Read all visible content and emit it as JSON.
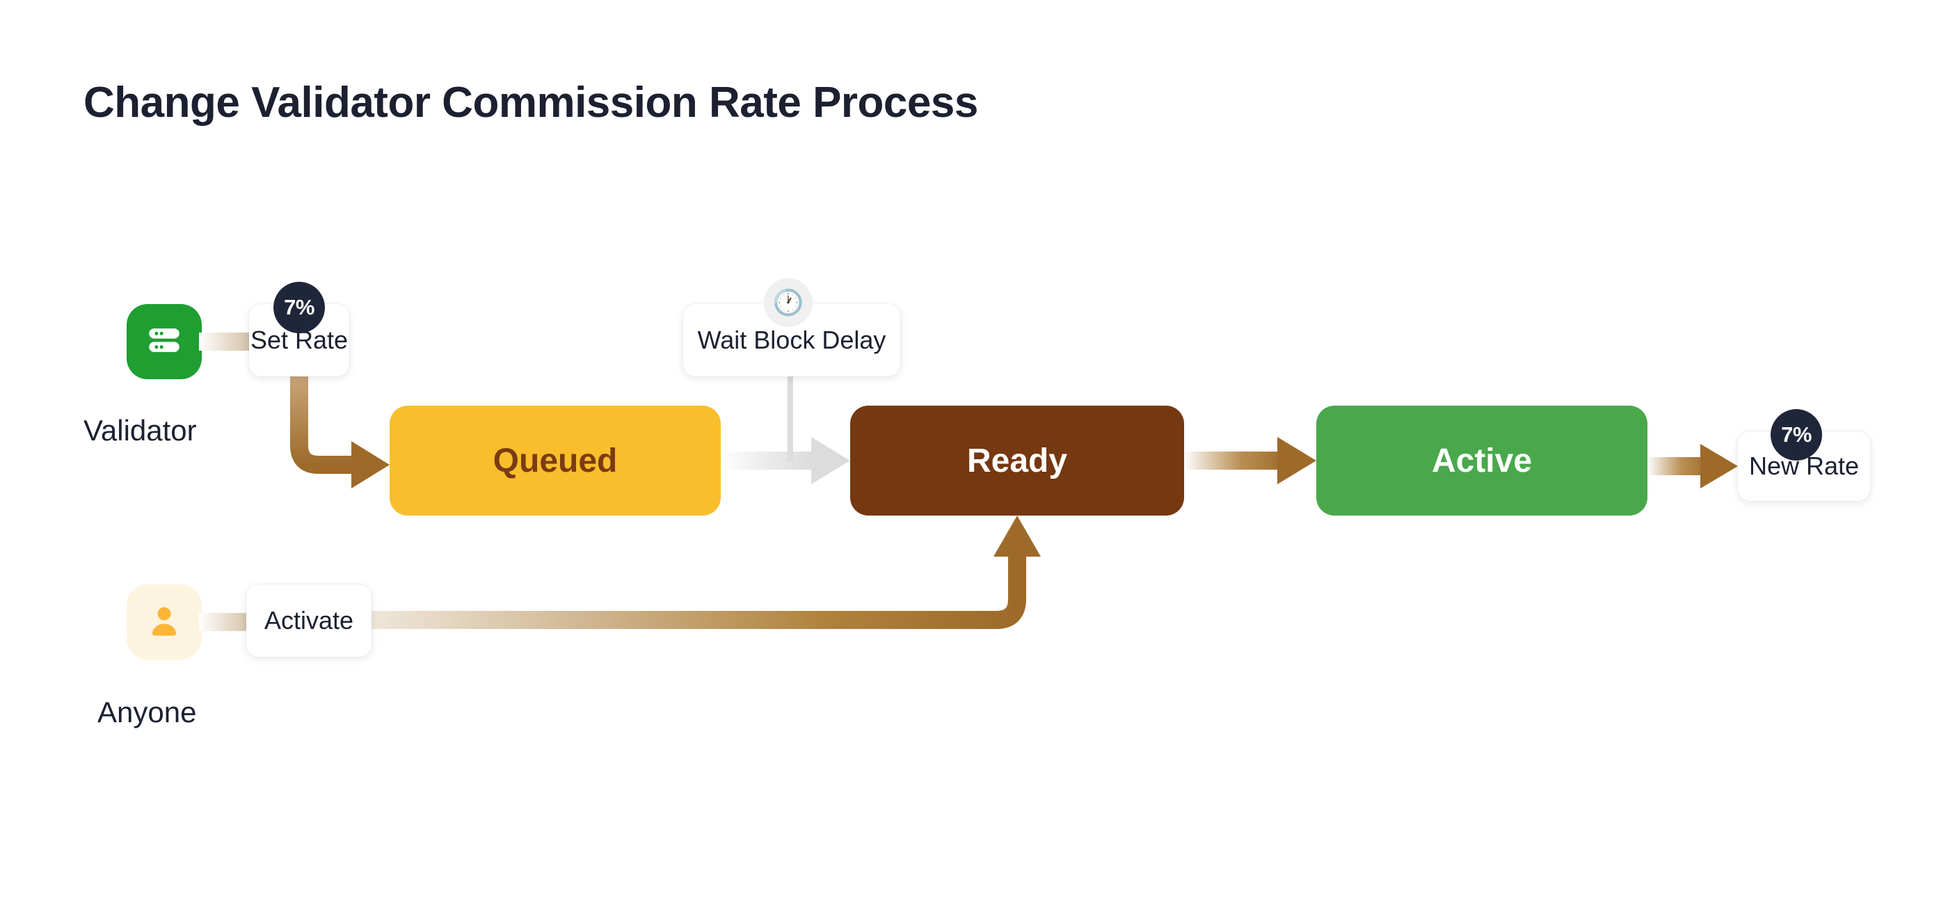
{
  "page": {
    "title": "Change Validator Commission Rate Process",
    "background_color": "#ffffff"
  },
  "actors": [
    {
      "id": "validator",
      "label": "Validator",
      "icon": "server-icon",
      "tile_color": "#1f9e32",
      "icon_color": "#ffffff"
    },
    {
      "id": "anyone",
      "label": "Anyone",
      "icon": "person-icon",
      "tile_color": "#fdf4e0",
      "icon_color": "#fbb638"
    }
  ],
  "actions": [
    {
      "id": "set-rate",
      "label": "Set Rate",
      "badge": "7%",
      "badge_kind": "percent",
      "badge_color": "#20263a",
      "actor": "validator",
      "target": "queued"
    },
    {
      "id": "wait-block-delay",
      "label": "Wait Block Delay",
      "badge": "🕐",
      "badge_kind": "clock-icon",
      "badge_color": "#f0f0f0",
      "actor": "",
      "target": "ready"
    },
    {
      "id": "activate",
      "label": "Activate",
      "badge": "",
      "badge_kind": "none",
      "badge_color": "",
      "actor": "anyone",
      "target": "ready"
    },
    {
      "id": "new-rate",
      "label": "New Rate",
      "badge": "7%",
      "badge_kind": "percent",
      "badge_color": "#20263a",
      "actor": "",
      "target": ""
    }
  ],
  "states": [
    {
      "id": "queued",
      "label": "Queued",
      "fill": "#fabe2c",
      "text_color": "#7a3b11"
    },
    {
      "id": "ready",
      "label": "Ready",
      "fill": "#763810",
      "text_color": "#ffffff"
    },
    {
      "id": "active",
      "label": "Active",
      "fill": "#4aa84c",
      "text_color": "#ffffff"
    }
  ],
  "flows": [
    {
      "id": "set-rate-to-queued",
      "from": "set-rate",
      "to": "queued",
      "color": "#9d6a2a",
      "style": "elbow-down-right"
    },
    {
      "id": "queued-to-ready",
      "from": "queued",
      "to": "ready",
      "color": "#d8d8d8",
      "style": "straight"
    },
    {
      "id": "wait-delay-to-edge",
      "from": "wait-block-delay",
      "to": "queued-to-ready",
      "color": "#d8d8d8",
      "style": "vertical-tick"
    },
    {
      "id": "ready-to-active",
      "from": "ready",
      "to": "active",
      "color": "#9d6a2a",
      "style": "straight"
    },
    {
      "id": "active-to-new-rate",
      "from": "active",
      "to": "new-rate",
      "color": "#9d6a2a",
      "style": "straight"
    },
    {
      "id": "activate-to-ready",
      "from": "activate",
      "to": "ready",
      "color": "#9d6a2a",
      "style": "elbow-right-up"
    }
  ],
  "colors": {
    "accent_brown": "#9d6a2a",
    "accent_green": "#4aa84c",
    "accent_amber": "#fabe2c",
    "accent_dark": "#20263a",
    "neutral_gray": "#d8d8d8"
  }
}
